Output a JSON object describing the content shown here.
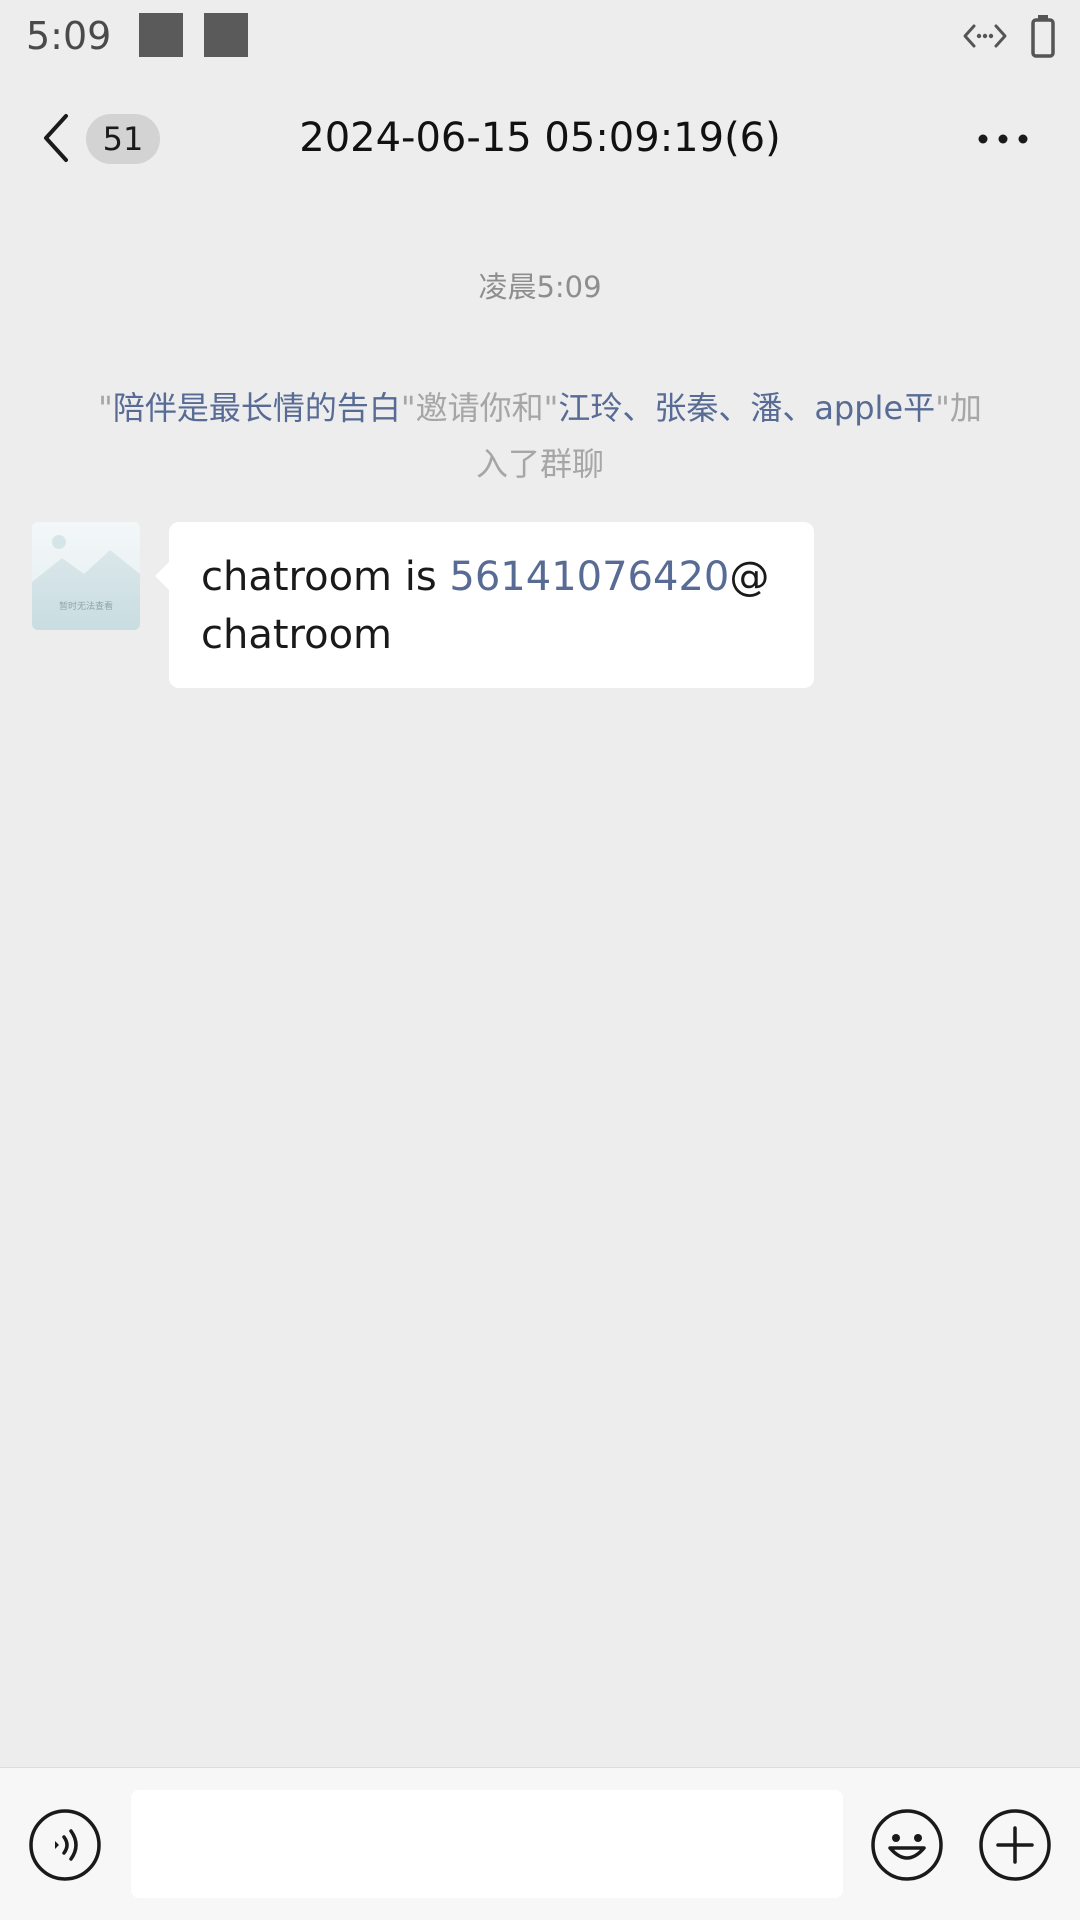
{
  "status_bar": {
    "time": "5:09",
    "icons": [
      "notification-square-icon",
      "notification-square-icon",
      "data-transfer-icon",
      "battery-icon"
    ]
  },
  "header": {
    "unread_count": "51",
    "title": "2024-06-15 05:09:19(6)",
    "icons": [
      "back-chevron-icon",
      "more-dots-icon"
    ]
  },
  "chat": {
    "timestamp": "凌晨5:09",
    "system_message": {
      "quote_open": "\"",
      "inviter": "陪伴是最长情的告白",
      "middle": "\"邀请你和\"",
      "invitees": "江玲、张秦、潘、apple平",
      "end": "\"加入了群聊"
    },
    "messages": [
      {
        "avatar_icon": "image-placeholder-icon",
        "avatar_caption": "暂时无法查看",
        "text_before": "chatroom is ",
        "link_text": "56141076420",
        "text_after": "@chatroom"
      }
    ]
  },
  "input_bar": {
    "text_value": "",
    "icons": [
      "voice-icon",
      "emoji-icon",
      "plus-icon"
    ]
  },
  "colors": {
    "background": "#ededed",
    "link": "#576b95",
    "bubble": "#ffffff",
    "badge": "#d3d3d3",
    "muted_text": "#a6a6a6"
  }
}
